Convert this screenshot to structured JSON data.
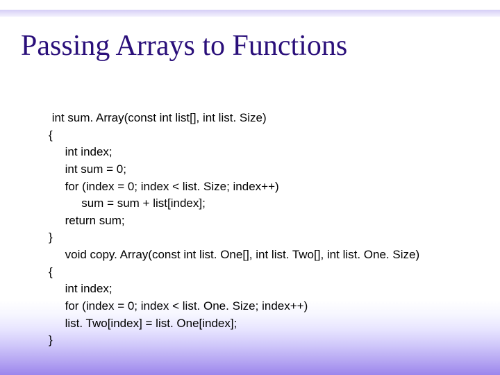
{
  "slide": {
    "title": "Passing Arrays to Functions",
    "code": {
      "l1": " int sum. Array(const int list[], int list. Size)",
      "l2": "{",
      "l3": "     int index;",
      "l4": "     int sum = 0;",
      "l5": "     for (index = 0; index < list. Size; index++)",
      "l6": "          sum = sum + list[index];",
      "l7": "     return sum;",
      "l8": "}",
      "l9": "     void copy. Array(const int list. One[], int list. Two[], int list. One. Size)",
      "l10": "{",
      "l11": "     int index;",
      "l12": "     for (index = 0; index < list. One. Size; index++)",
      "l13": "     list. Two[index] = list. One[index];",
      "l14": "}"
    }
  }
}
